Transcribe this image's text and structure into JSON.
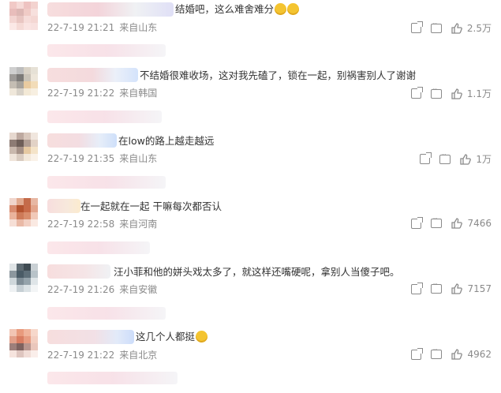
{
  "comments": [
    {
      "text": "结婚吧，这么难舍难分",
      "emoji_count": 2,
      "meta": "22-7-19 21:21",
      "location": "来自山东",
      "likes": "2.5万"
    },
    {
      "text": "不结婚很难收场，这对我先磕了，锁在一起，别祸害别人了谢谢",
      "emoji_count": 0,
      "meta": "22-7-19 21:22",
      "location": "来自韩国",
      "likes": "1.1万"
    },
    {
      "text": "在low的路上越走越远",
      "emoji_count": 0,
      "meta": "22-7-19 21:35",
      "location": "来自山东",
      "likes": "1万"
    },
    {
      "text": "在一起就在一起 干嘛每次都否认",
      "emoji_count": 0,
      "meta": "22-7-19 22:58",
      "location": "来自河南",
      "likes": "7466"
    },
    {
      "text": "汪小菲和他的姘头戏太多了，就这样还嘴硬呢，拿别人当傻子吧。",
      "emoji_count": 0,
      "meta": "22-7-19 21:26",
      "location": "来自安徽",
      "likes": "7157"
    },
    {
      "text": "这几个人都挺",
      "emoji_count": 1,
      "meta": "22-7-19 21:22",
      "location": "来自北京",
      "likes": "4962"
    }
  ],
  "icons": {
    "share": "share-icon",
    "comment": "comment-icon",
    "like": "thumbs-up-icon"
  },
  "colors": {
    "meta_text": "#8a8a8a",
    "body_text": "#333333"
  }
}
